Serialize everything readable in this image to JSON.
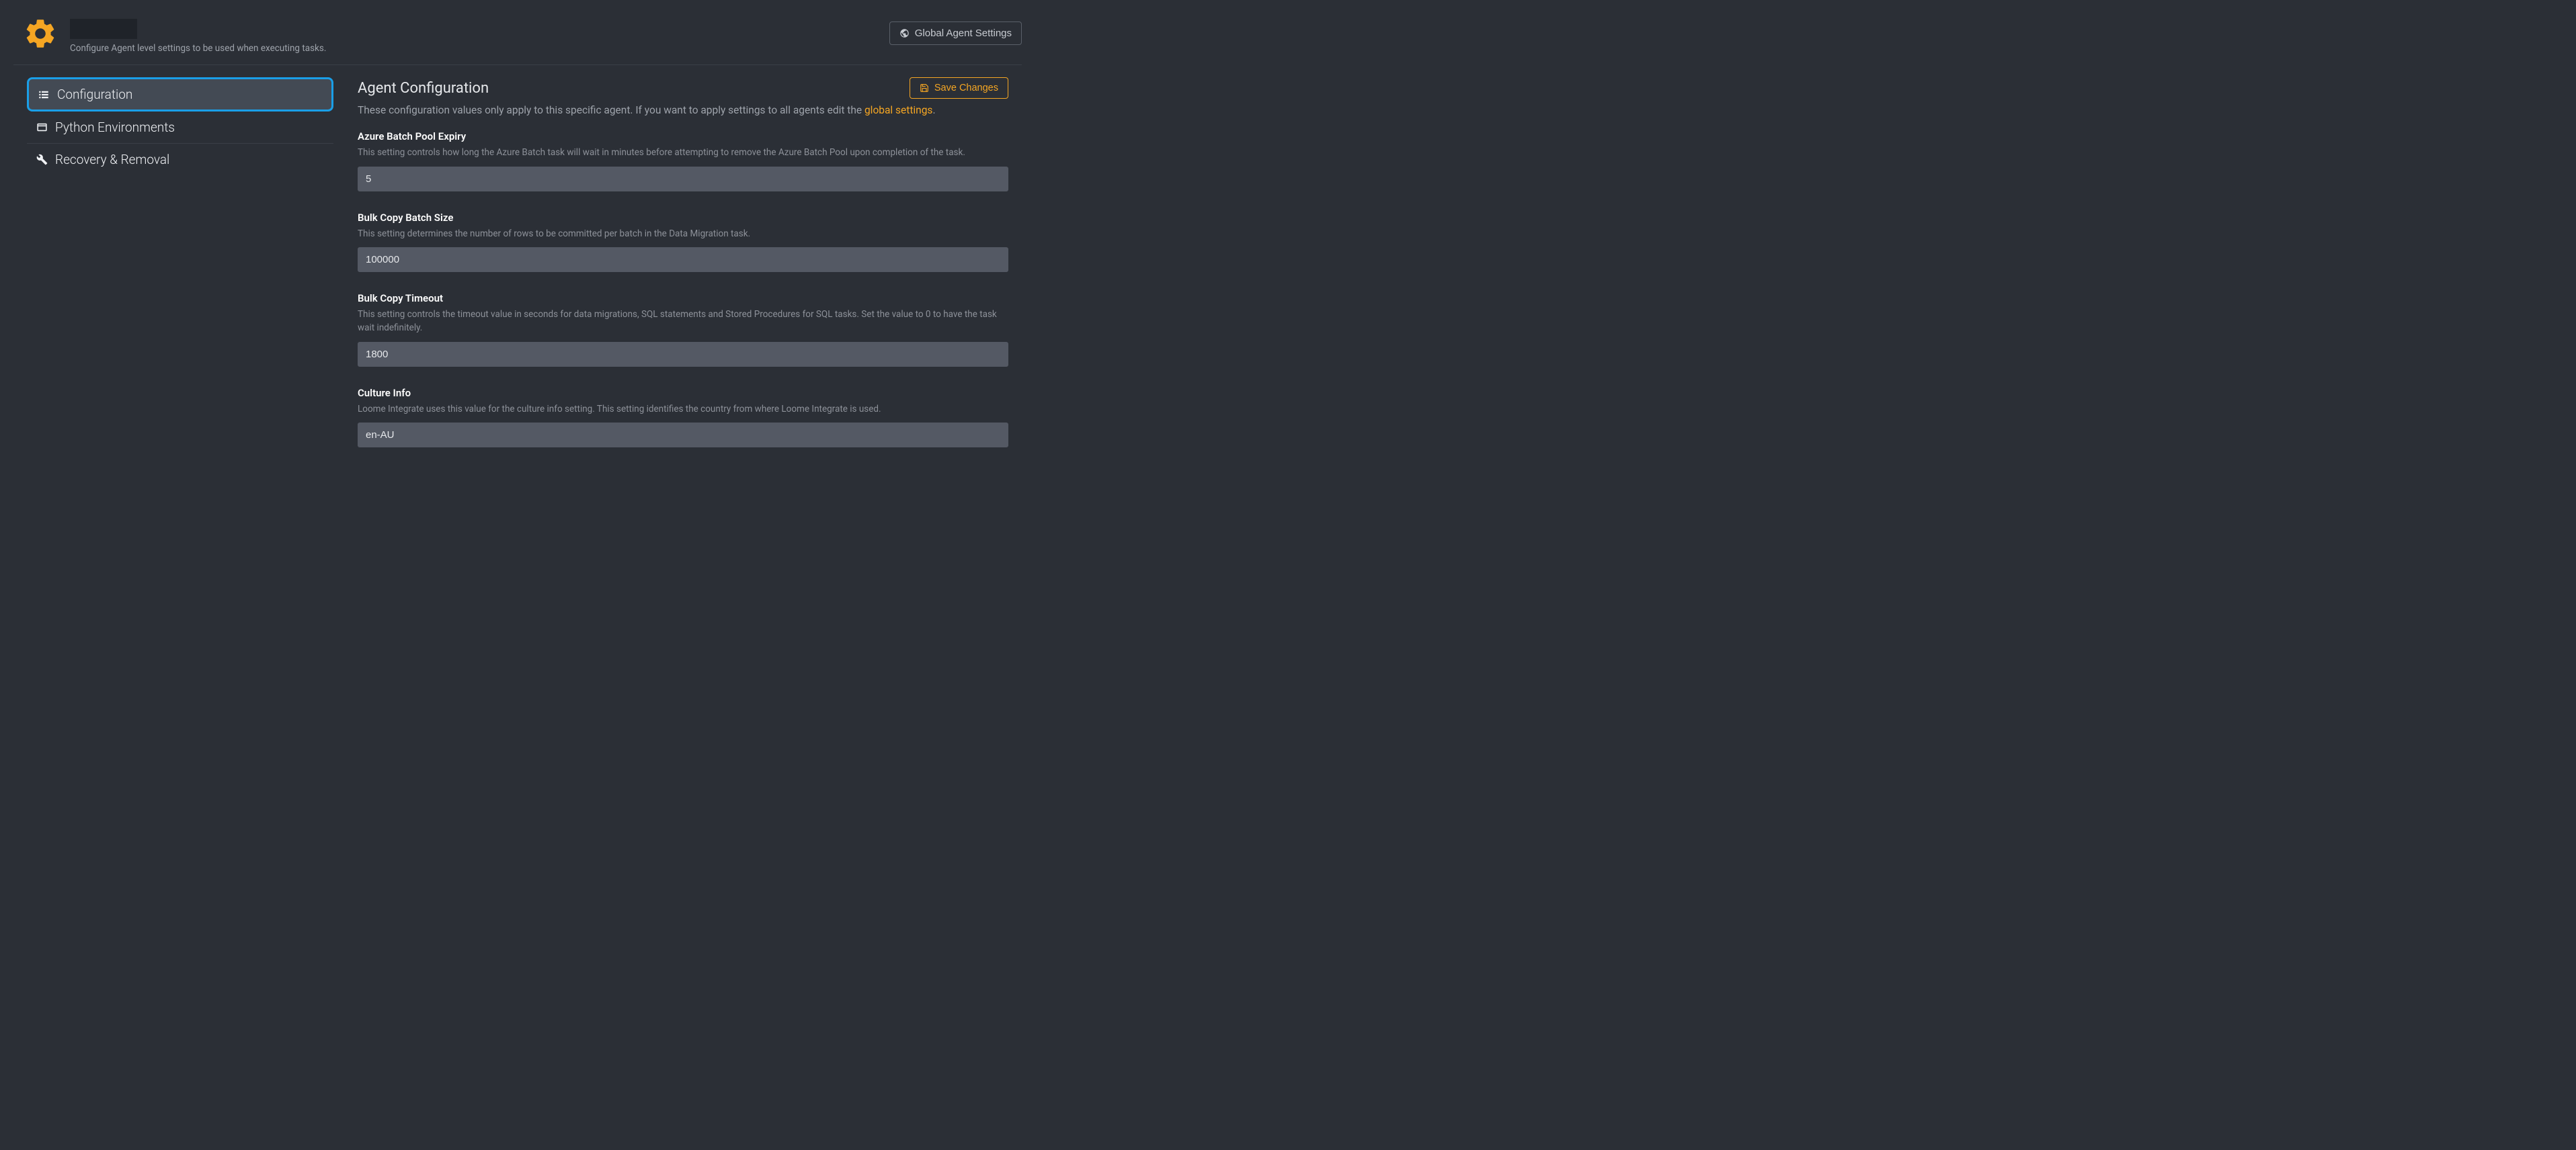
{
  "header": {
    "subtitle": "Configure Agent level settings to be used when executing tasks.",
    "global_button": "Global Agent Settings"
  },
  "sidebar": {
    "tabs": [
      {
        "label": "Configuration"
      },
      {
        "label": "Python Environments"
      },
      {
        "label": "Recovery & Removal"
      }
    ]
  },
  "main": {
    "title": "Agent Configuration",
    "save_button": "Save Changes",
    "intro_prefix": "These configuration values only apply to this specific agent. If you want to apply settings to all agents edit the ",
    "intro_link": "global settings",
    "intro_suffix": ".",
    "fields": [
      {
        "label": "Azure Batch Pool Expiry",
        "desc": "This setting controls how long the Azure Batch task will wait in minutes before attempting to remove the Azure Batch Pool upon completion of the task.",
        "value": "5"
      },
      {
        "label": "Bulk Copy Batch Size",
        "desc": "This setting determines the number of rows to be committed per batch in the Data Migration task.",
        "value": "100000"
      },
      {
        "label": "Bulk Copy Timeout",
        "desc": "This setting controls the timeout value in seconds for data migrations, SQL statements and Stored Procedures for SQL tasks. Set the value to 0 to have the task wait indefinitely.",
        "value": "1800"
      },
      {
        "label": "Culture Info",
        "desc": "Loome Integrate uses this value for the culture info setting. This setting identifies the country from where Loome Integrate is used.",
        "value": "en-AU"
      }
    ]
  }
}
